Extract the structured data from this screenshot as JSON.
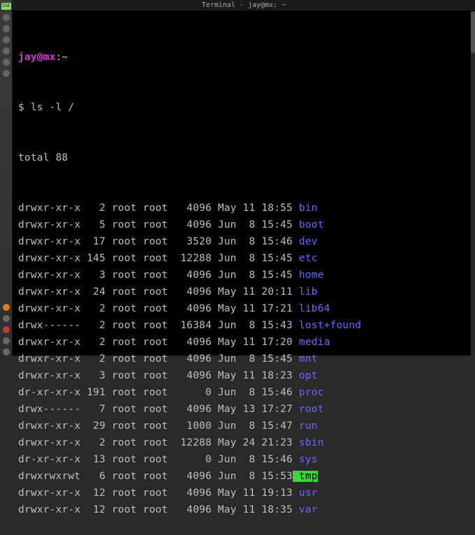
{
  "window": {
    "title": "Terminal - jay@mx: ~"
  },
  "taskbar": {
    "badge": "358"
  },
  "prompt": {
    "userhost": "jay@mx",
    "colon": ":",
    "path": "~",
    "symbol": "$ ",
    "command": "ls -l /"
  },
  "total_line": "total 88",
  "rows": [
    {
      "perm": "drwxr-xr-x",
      "links": "2",
      "owner": "root",
      "group": "root",
      "size": "4096",
      "month": "May",
      "day": "11",
      "time": "18:55",
      "name": "bin",
      "kind": "dir"
    },
    {
      "perm": "drwxr-xr-x",
      "links": "5",
      "owner": "root",
      "group": "root",
      "size": "4096",
      "month": "Jun",
      "day": "8",
      "time": "15:45",
      "name": "boot",
      "kind": "dir"
    },
    {
      "perm": "drwxr-xr-x",
      "links": "17",
      "owner": "root",
      "group": "root",
      "size": "3520",
      "month": "Jun",
      "day": "8",
      "time": "15:46",
      "name": "dev",
      "kind": "dir"
    },
    {
      "perm": "drwxr-xr-x",
      "links": "145",
      "owner": "root",
      "group": "root",
      "size": "12288",
      "month": "Jun",
      "day": "8",
      "time": "15:45",
      "name": "etc",
      "kind": "dir"
    },
    {
      "perm": "drwxr-xr-x",
      "links": "3",
      "owner": "root",
      "group": "root",
      "size": "4096",
      "month": "Jun",
      "day": "8",
      "time": "15:45",
      "name": "home",
      "kind": "dir"
    },
    {
      "perm": "drwxr-xr-x",
      "links": "24",
      "owner": "root",
      "group": "root",
      "size": "4096",
      "month": "May",
      "day": "11",
      "time": "20:11",
      "name": "lib",
      "kind": "dir"
    },
    {
      "perm": "drwxr-xr-x",
      "links": "2",
      "owner": "root",
      "group": "root",
      "size": "4096",
      "month": "May",
      "day": "11",
      "time": "17:21",
      "name": "lib64",
      "kind": "dir"
    },
    {
      "perm": "drwx------",
      "links": "2",
      "owner": "root",
      "group": "root",
      "size": "16384",
      "month": "Jun",
      "day": "8",
      "time": "15:43",
      "name": "lost+found",
      "kind": "lost"
    },
    {
      "perm": "drwxr-xr-x",
      "links": "2",
      "owner": "root",
      "group": "root",
      "size": "4096",
      "month": "May",
      "day": "11",
      "time": "17:20",
      "name": "media",
      "kind": "dir"
    },
    {
      "perm": "drwxr-xr-x",
      "links": "2",
      "owner": "root",
      "group": "root",
      "size": "4096",
      "month": "Jun",
      "day": "8",
      "time": "15:45",
      "name": "mnt",
      "kind": "dir"
    },
    {
      "perm": "drwxr-xr-x",
      "links": "3",
      "owner": "root",
      "group": "root",
      "size": "4096",
      "month": "May",
      "day": "11",
      "time": "18:23",
      "name": "opt",
      "kind": "dir"
    },
    {
      "perm": "dr-xr-xr-x",
      "links": "191",
      "owner": "root",
      "group": "root",
      "size": "0",
      "month": "Jun",
      "day": "8",
      "time": "15:46",
      "name": "proc",
      "kind": "dir"
    },
    {
      "perm": "drwx------",
      "links": "7",
      "owner": "root",
      "group": "root",
      "size": "4096",
      "month": "May",
      "day": "13",
      "time": "17:27",
      "name": "root",
      "kind": "dir"
    },
    {
      "perm": "drwxr-xr-x",
      "links": "29",
      "owner": "root",
      "group": "root",
      "size": "1000",
      "month": "Jun",
      "day": "8",
      "time": "15:47",
      "name": "run",
      "kind": "dir"
    },
    {
      "perm": "drwxr-xr-x",
      "links": "2",
      "owner": "root",
      "group": "root",
      "size": "12288",
      "month": "May",
      "day": "24",
      "time": "21:23",
      "name": "sbin",
      "kind": "dir"
    },
    {
      "perm": "dr-xr-xr-x",
      "links": "13",
      "owner": "root",
      "group": "root",
      "size": "0",
      "month": "Jun",
      "day": "8",
      "time": "15:46",
      "name": "sys",
      "kind": "dir"
    },
    {
      "perm": "drwxrwxrwt",
      "links": "6",
      "owner": "root",
      "group": "root",
      "size": "4096",
      "month": "Jun",
      "day": "8",
      "time": "15:53",
      "name": "tmp",
      "kind": "tmp"
    },
    {
      "perm": "drwxr-xr-x",
      "links": "12",
      "owner": "root",
      "group": "root",
      "size": "4096",
      "month": "May",
      "day": "11",
      "time": "19:13",
      "name": "usr",
      "kind": "dir"
    },
    {
      "perm": "drwxr-xr-x",
      "links": "12",
      "owner": "root",
      "group": "root",
      "size": "4096",
      "month": "May",
      "day": "11",
      "time": "18:35",
      "name": "var",
      "kind": "dir"
    }
  ]
}
